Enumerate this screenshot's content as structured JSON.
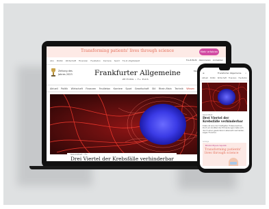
{
  "laptop": {
    "ad": {
      "text": "Transforming patients' lives through science",
      "button": "Mehr erfahren"
    },
    "topbar": {
      "items": [
        "Abo",
        "Politik",
        "Wirtschaft",
        "Finanzen",
        "Feuilleton",
        "Karriere",
        "Sport",
        "F.A.Z.-Digitalwelt"
      ],
      "right": [
        "F.A.Z.PLUS",
        "Abonnieren",
        "Anmelden"
      ]
    },
    "award": {
      "line1": "Zeitung des",
      "line2": "Jahres 2023"
    },
    "masthead": "Frankfurter Allgemeine",
    "edition": "ZEITUNG • F+ PLUS",
    "meta": "Montag, 23. Januar 2023",
    "nav": {
      "items": [
        "Aktuell",
        "Politik",
        "Wirtschaft",
        "Finanzen",
        "Feuilleton",
        "Karriere",
        "Sport",
        "Gesellschaft",
        "Stil",
        "Rhein-Main",
        "Technik",
        "Wissen"
      ],
      "button": "Suche"
    },
    "article": {
      "kicker": "Gesundheit – F+",
      "headline": "Drei Viertel der Krebsfälle verhinderbar"
    }
  },
  "phone": {
    "topbar": {
      "left": "≡",
      "center": "Frankfurter Allgemeine",
      "right": "⌕"
    },
    "nav": [
      "Aktuell",
      "Politik",
      "Wirtschaft",
      "Finanzen",
      "Feuilleton"
    ],
    "article": {
      "kicker": "Gesundheit",
      "headline": "Drei Viertel der Krebsfälle verhinderbar",
      "body": "Krebs ist eine der häufigsten Todesursachen. Doch ein Großteil der Erkrankungen ließe sich durch einen gesünderen Lebensstil vermeiden, sagen Forscher."
    },
    "ad": {
      "label": "Anzeige",
      "logo": "Bristol Myers Squibb",
      "text": "Transforming patients' lives through science"
    }
  },
  "colors": {
    "ad_bg": "#fdeae6",
    "ad_text": "#e46f5a",
    "ad_button": "#d24ca3",
    "device": "#111111"
  }
}
